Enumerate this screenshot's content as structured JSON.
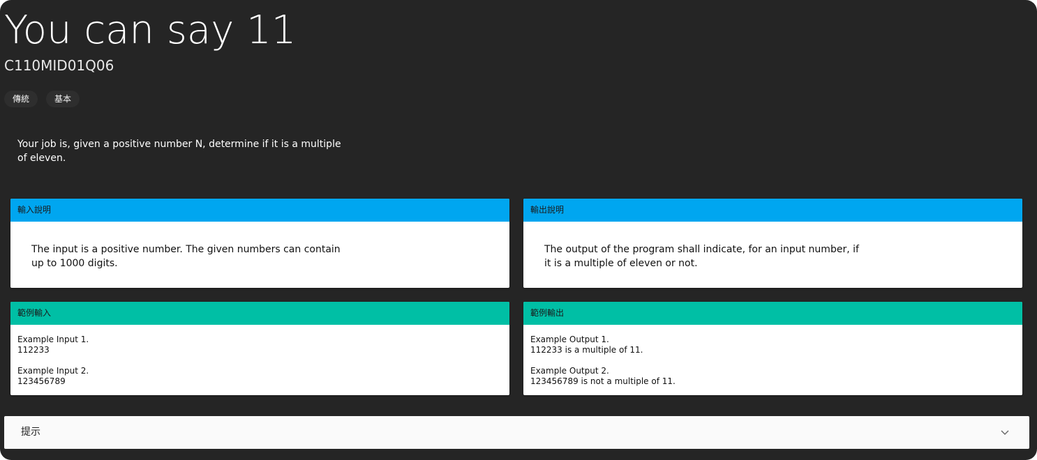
{
  "problem": {
    "title": "You can say 11",
    "code": "C110MID01Q06",
    "tags": [
      "傳統",
      "基本"
    ],
    "description": "Your job is, given a positive number N, determine if it is a multiple of eleven."
  },
  "input_spec": {
    "header": "輸入說明",
    "body": "The input is a positive number. The given numbers can contain up to 1000 digits."
  },
  "output_spec": {
    "header": "輸出說明",
    "body": "The output of the program shall indicate, for an input number, if it is a multiple of eleven or not."
  },
  "sample_input": {
    "header": "範例輸入",
    "body": "Example Input 1.\n112233\n\nExample Input 2.\n123456789"
  },
  "sample_output": {
    "header": "範例輸出",
    "body": "Example Output 1.\n112233 is a multiple of 11.\n\nExample Output 2.\n123456789 is not a multiple of 11."
  },
  "hint": {
    "label": "提示",
    "icon": "chevron-down-icon"
  },
  "colors": {
    "background": "#252525",
    "header_blue": "#00a6f0",
    "header_teal": "#00bfa5"
  }
}
